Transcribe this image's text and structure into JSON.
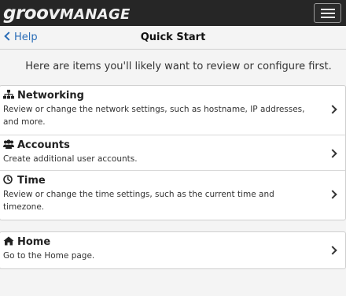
{
  "app": {
    "brand_part1": "groov",
    "brand_part2": "MANAGE",
    "menu_icon": "hamburger-icon"
  },
  "nav": {
    "back_label": "Help",
    "back_icon": "chevron-left-icon",
    "title": "Quick Start"
  },
  "intro": "Here are items you'll likely want to review or configure first.",
  "items": [
    {
      "title": "Networking",
      "icon": "network-icon",
      "description": "Review or change the network settings, such as hostname, IP addresses, and more."
    },
    {
      "title": "Accounts",
      "icon": "users-icon",
      "description": "Create additional user accounts."
    },
    {
      "title": "Time",
      "icon": "clock-icon",
      "description": "Review or change the time settings, such as the current time and timezone."
    }
  ],
  "home_item": {
    "title": "Home",
    "icon": "home-icon",
    "description": "Go to the Home page."
  },
  "colors": {
    "topbar": "#262626",
    "link": "#2a6db7",
    "background": "#f4f4f4"
  }
}
